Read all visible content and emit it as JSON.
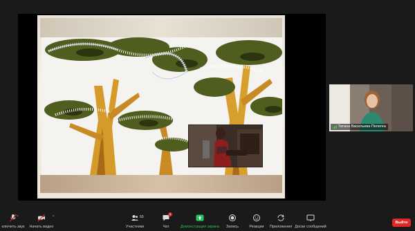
{
  "participant_tile": {
    "name": "Татана Васильева Пелегеа"
  },
  "toolbar": {
    "mute_label": "ключить звук",
    "video_label": "Начать видео",
    "participants_label": "Участники",
    "participants_count": "50",
    "chat_label": "Чат",
    "chat_badge": "1",
    "share_label": "Демонстрация экрана",
    "record_label": "Запись",
    "reactions_label": "Реакции",
    "apps_label": "Приложения",
    "whiteboard_label": "Доски сообщений",
    "leave_label": "Выйти"
  },
  "colors": {
    "accent_green": "#22c55e",
    "leave_red": "#e02828"
  }
}
